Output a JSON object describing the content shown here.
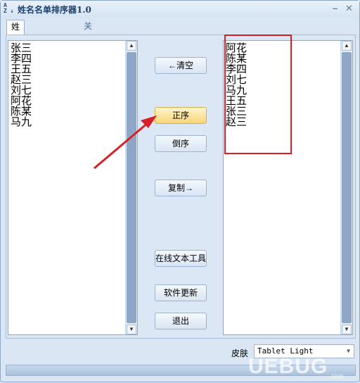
{
  "window": {
    "title": "姓名名单排序器1.0",
    "minimize": "–",
    "close": "✕"
  },
  "tabs": [
    {
      "label": "姓名名单排序器",
      "active": true
    },
    {
      "label": "关于",
      "active": false
    }
  ],
  "left_list": [
    "张三",
    "李四",
    "王五",
    "赵三",
    "刘七",
    "阿花",
    "陈某",
    "马九"
  ],
  "right_list": [
    "阿花",
    "陈某",
    "李四",
    "刘七",
    "马九",
    "王五",
    "张三",
    "赵三"
  ],
  "buttons": {
    "clear": "←清空",
    "ascending": "正序",
    "descending": "倒序",
    "copy": "复制→",
    "online_tools": "在线文本工具",
    "update": "软件更新",
    "exit": "退出"
  },
  "skin": {
    "label": "皮肤",
    "value": "Tablet Light"
  },
  "watermark": {
    "text": "UEBUG",
    "sub": ".com"
  },
  "colors": {
    "highlight_box": "#d81f26",
    "arrow": "#d81f26",
    "active_button": "#f8d57a"
  }
}
